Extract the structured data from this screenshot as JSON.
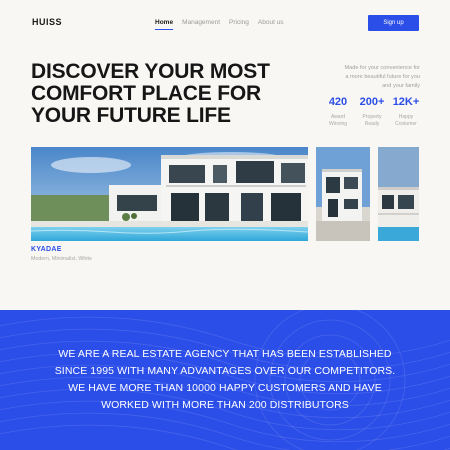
{
  "brand": {
    "logo": "HUISS",
    "accent": "#2c4ee8"
  },
  "nav": {
    "items": [
      {
        "label": "Home",
        "active": true
      },
      {
        "label": "Management",
        "active": false
      },
      {
        "label": "Pricing",
        "active": false
      },
      {
        "label": "About us",
        "active": false
      }
    ],
    "signup_label": "Sign up"
  },
  "hero": {
    "headline_lines": [
      "DISCOVER YOUR MOST",
      "COMFORT PLACE FOR",
      "YOUR FUTURE LIFE"
    ],
    "tagline_lines": [
      "Made for your convenience for",
      "a more beautiful future for you",
      "and your family"
    ],
    "stats": [
      {
        "value": "420",
        "label_lines": [
          "Award",
          "Winning"
        ]
      },
      {
        "value": "200+",
        "label_lines": [
          "Property",
          "Ready"
        ]
      },
      {
        "value": "12K+",
        "label_lines": [
          "Happy",
          "Costumer"
        ]
      }
    ]
  },
  "gallery": {
    "caption_title": "KYADAE",
    "caption_sub": "Modern, Minimalist, White",
    "photos": [
      "villa-photo",
      "house-photo",
      "building-photo"
    ]
  },
  "about": {
    "lines": [
      "WE ARE A REAL ESTATE AGENCY THAT HAS BEEN ESTABLISHED",
      "SINCE 1995 WITH MANY ADVANTAGES OVER OUR COMPETITORS.",
      "WE HAVE MORE THAN 10000 HAPPY CUSTOMERS AND HAVE",
      "WORKED WITH MORE THAN 200 DISTRIBUTORS"
    ]
  }
}
